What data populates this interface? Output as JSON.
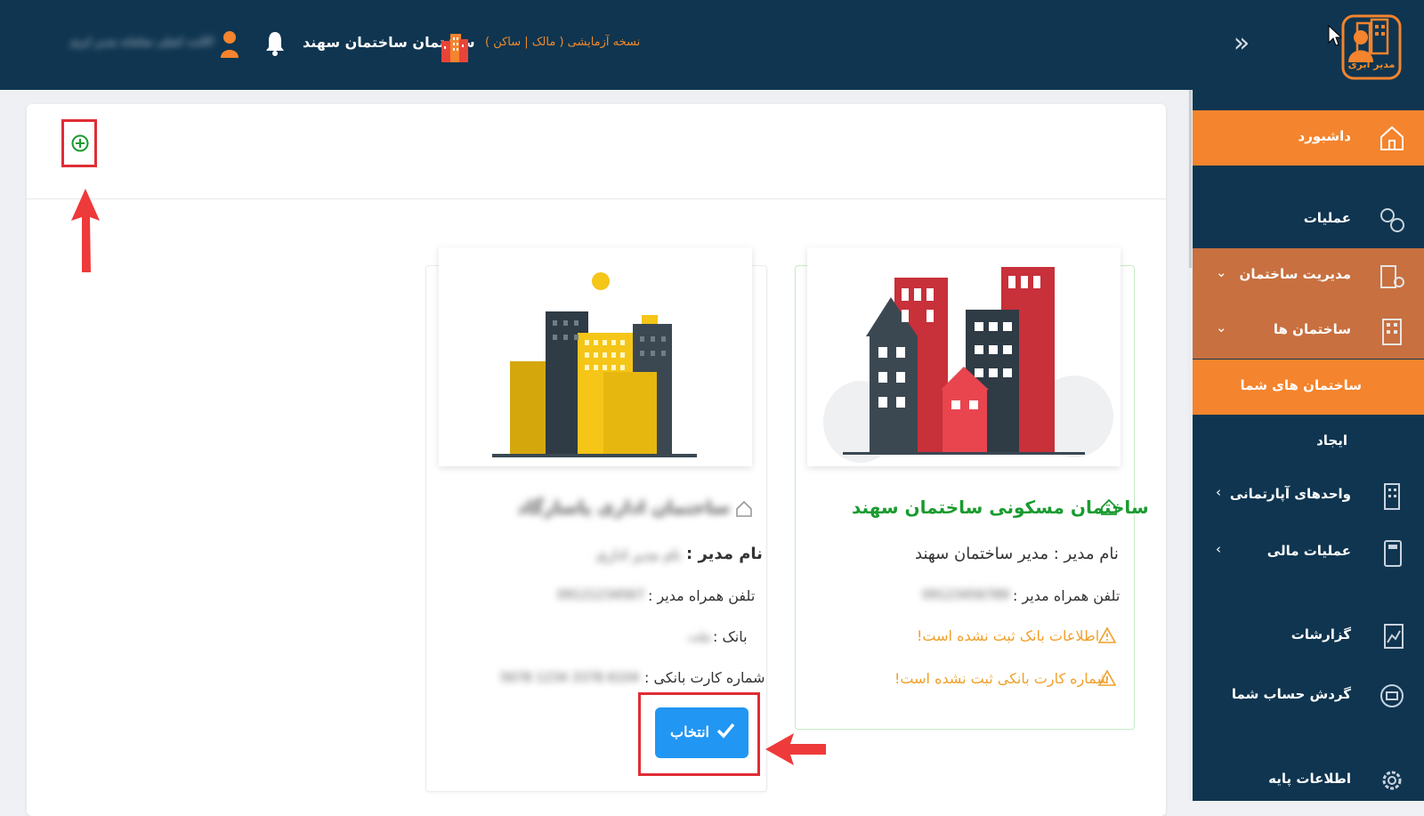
{
  "header": {
    "trial_label": "نسخه آزمایشی  ( مالک | ساکن )",
    "building_title": "ساختمان ساختمان سهند",
    "user_name": "اکانت اصلی سامانه مدیر ابری",
    "logo_text": "مدیر ابری"
  },
  "sidebar": {
    "dashboard": "داشبورد",
    "operations": "عملیات",
    "building_management": "مدیریت ساختمان",
    "buildings": "ساختمان ها",
    "your_buildings": "ساختمان های شما",
    "create": "ایجاد",
    "apartment_units": "واحدهای آپارتمانی",
    "financial_operations": "عملیات مالی",
    "reports": "گزارشات",
    "account_turnover": "گردش حساب شما",
    "base_info": "اطلاعات پایه"
  },
  "cards": {
    "right": {
      "title": "ساختمان مسکونی ساختمان سهند",
      "manager": "نام مدیر : مدیر ساختمان سهند",
      "phone_label": "تلفن همراه مدیر :",
      "phone_value": "09123456789",
      "bank_warning": "اطلاعات بانک ثبت نشده است!",
      "card_warning": "شماره کارت بانکی ثبت نشده است!"
    },
    "left": {
      "title": "ساختمان اداری پاسارگاد",
      "manager_label": "نام مدیر :",
      "manager_value": "نام مدیر اداری",
      "phone_label": "تلفن همراه مدیر :",
      "phone_value": "09121234567",
      "bank_label": "بانک :",
      "bank_value": "ملت",
      "card_label": "شماره کارت بانکی :",
      "card_value": "6104 3378 1234 5678",
      "select_label": "انتخاب"
    }
  },
  "colors": {
    "topbar": "#0f3550",
    "accent": "#f4842d",
    "success": "#1a9b2f",
    "primary_button": "#2196f3",
    "highlight": "#e02d35",
    "warning": "#f0a02a"
  },
  "icons": [
    "logo-icon",
    "collapse-icon",
    "building-icon",
    "bell-icon",
    "user-icon",
    "home-icon",
    "add-icon",
    "check-icon",
    "warning-icon"
  ]
}
